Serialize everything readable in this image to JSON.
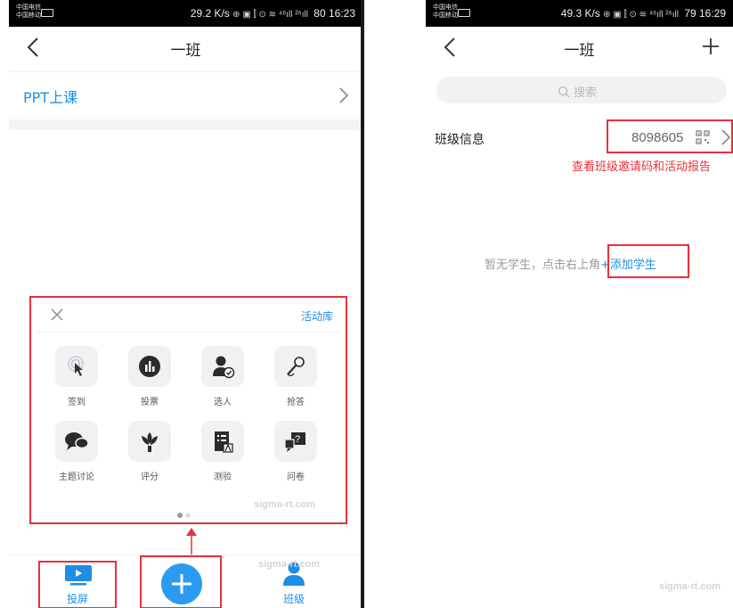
{
  "left_phone": {
    "status": {
      "carrier_line1": "中国电信",
      "carrier_line2": "中国移动",
      "speed": "29.2 K/s",
      "icons": "⊕ ▣ ⫿ ⊙ ≋ ⁴⁶ıll ²⁶ıll",
      "battery": "80",
      "time": "16:23"
    },
    "nav": {
      "title": "一班"
    },
    "ppt_row": {
      "label": "PPT上课"
    },
    "panel": {
      "library_link": "活动库",
      "items": [
        {
          "label": "签到",
          "icon": "tap-icon"
        },
        {
          "label": "投票",
          "icon": "chart-bar-icon"
        },
        {
          "label": "选人",
          "icon": "person-check-icon"
        },
        {
          "label": "抢答",
          "icon": "microphone-icon"
        },
        {
          "label": "主题讨论",
          "icon": "chat-bubbles-icon"
        },
        {
          "label": "评分",
          "icon": "lotus-icon"
        },
        {
          "label": "测验",
          "icon": "quiz-icon"
        },
        {
          "label": "问卷",
          "icon": "question-card-icon"
        }
      ],
      "watermark": "sigma-rt.com"
    },
    "tabbar": {
      "cast_label": "投屏",
      "class_label": "班级",
      "watermark": "sigma-rt.com"
    }
  },
  "right_phone": {
    "status": {
      "carrier_line1": "中国电信",
      "carrier_line2": "中国移动",
      "speed": "49.3 K/s",
      "icons": "⊕ ▣ ⫿ ⊙ ≋ ⁴⁶ıll ²⁶ıll",
      "battery": "79",
      "time": "16:29"
    },
    "nav": {
      "title": "一班"
    },
    "search": {
      "placeholder": "搜索"
    },
    "class_info": {
      "label": "班级信息",
      "code": "8098605",
      "annotation": "查看班级邀请码和活动报告"
    },
    "empty": {
      "hint": "暂无学生，点击右上角",
      "link": "+添加学生"
    },
    "watermark": "sigma-rt.com"
  },
  "colors": {
    "accent_blue": "#1e8ee6",
    "highlight_red": "#e8313a",
    "fab_blue": "#2a9bf0"
  }
}
